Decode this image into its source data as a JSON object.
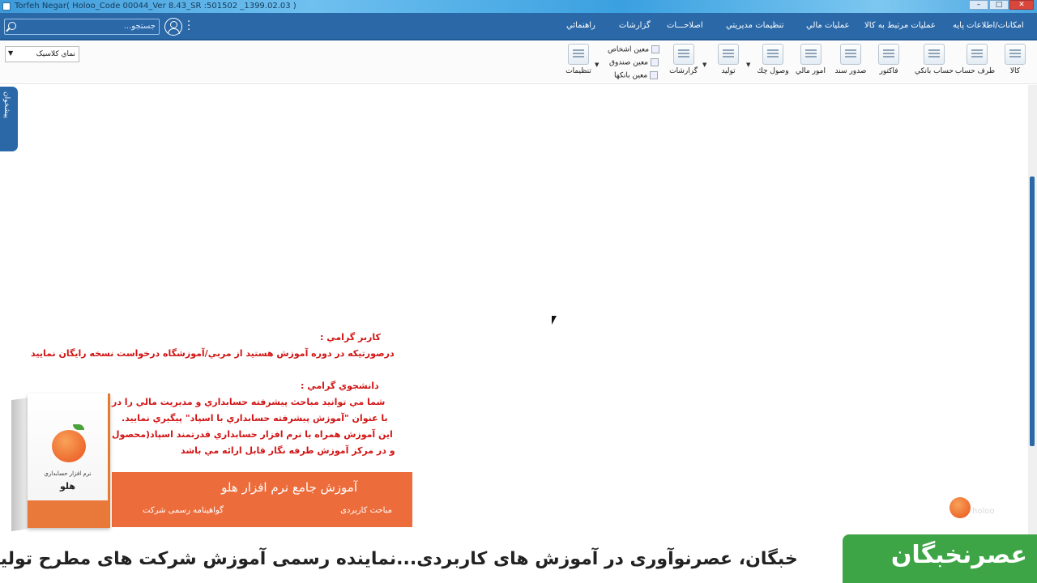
{
  "window": {
    "title": "Torfeh Negar( Holoo_Code 00044_Ver 8.43_SR :501502 _1399.02.03 )",
    "controls": [
      "–",
      "□",
      "✕"
    ]
  },
  "menubar": {
    "items": [
      "امکانات/اطلاعات پايه",
      "عمليات مرتبط به کالا",
      "عمليات مالي",
      "تنظيمات مديريتي",
      "اصلاحـــات",
      "گزارشات",
      "راهنمائي"
    ],
    "search_placeholder": "جستجو..."
  },
  "toolbar": {
    "buttons": [
      "کالا",
      "طرف حساب",
      "حساب بانکي",
      "فاکتور",
      "صدور سند",
      "امور مالي",
      "وصول چك",
      "توليد",
      "گزارشات",
      "تنظيمات"
    ],
    "small_items": [
      "معين اشخاص",
      "معين صندوق",
      "معين بانکها"
    ],
    "theme_select": "نماي کلاسيک"
  },
  "side_tab": "پیشخوان",
  "notice": {
    "line1": "کاربر گرامي :",
    "line2": "درصورتيکه در دوره آموزش هستيد از مربي/آموزشگاه درخواست نسخه رايگان نماييد",
    "line3": "دانشجوي گرامي :",
    "line4": "شما مي توانيد مباحث پيشرفته حسابداري و مديريت مالي را در",
    "line5": "با عنوان \"آموزش پيشرفته حسابداري با اسپاد\" پيگيري نماييد.",
    "line6": "اين آموزش همراه با نرم افزار حسابداري قدرتمند اسپاد(محصول",
    "line7": "و در مرکز آموزش طرفه نگار قابل ارائه مي باشد"
  },
  "product_box": {
    "subtitle": "نرم افزار حسابداري",
    "name": "هلو"
  },
  "banner": {
    "title": "آموزش جامع نرم افزار هلو",
    "left": "گواهینامه رسمی شرکت",
    "right": "مباحث کاربردی"
  },
  "ticker": {
    "text": "خبگان، عصرنوآوری در آموزش های کاربردی...نماینده رسمی آموزش شرکت های مطرح تولید",
    "logo": "عصرنخبگان"
  },
  "watermark": "holoo"
}
